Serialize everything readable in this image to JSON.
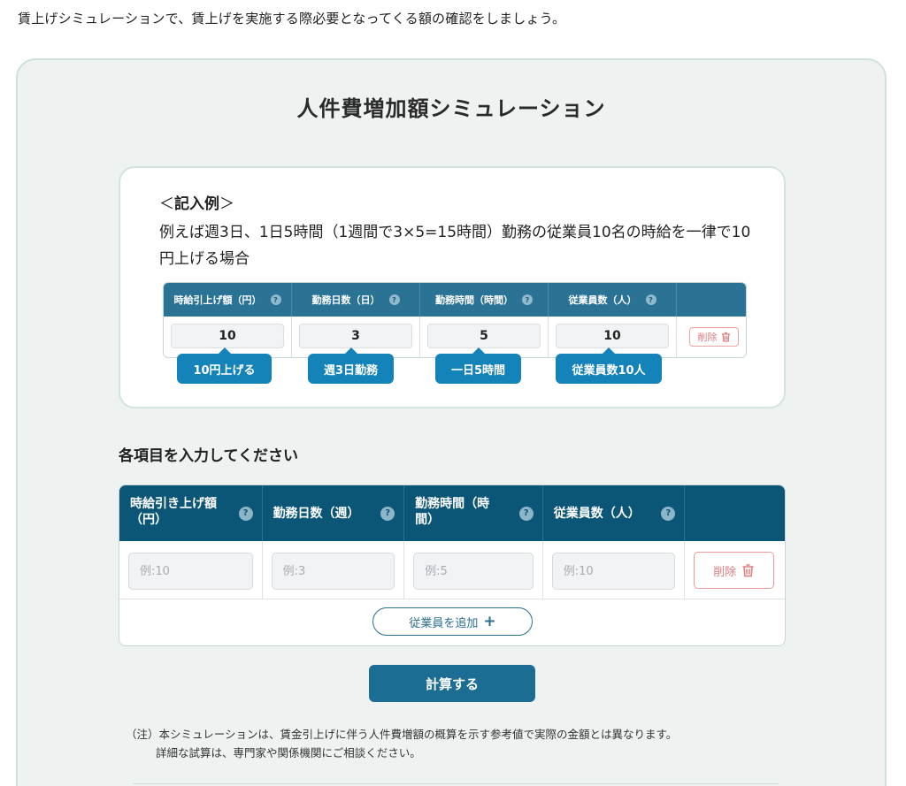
{
  "intro": "賃上げシミュレーションで、賃上げを実施する際必要となってくる額の確認をしましょう。",
  "panel": {
    "title": "人件費増加額シミュレーション"
  },
  "example": {
    "heading_open": "＜",
    "heading": "記入例",
    "heading_close": "＞",
    "description": "例えば週3日、1日5時間（1週間で3×5=15時間）勤務の従業員10名の時給を一律で10円上げる場合",
    "columns": [
      {
        "label": "時給引上げ額（円）",
        "help": "?"
      },
      {
        "label": "勤務日数（日）",
        "help": "?"
      },
      {
        "label": "勤務時間（時間）",
        "help": "?"
      },
      {
        "label": "従業員数（人）",
        "help": "?"
      }
    ],
    "values": [
      "10",
      "3",
      "5",
      "10"
    ],
    "delete_label": "削除",
    "callouts": [
      "10円上げる",
      "週3日勤務",
      "一日5時間",
      "従業員数10人"
    ]
  },
  "input_section": {
    "title": "各項目を入力してください",
    "columns": [
      {
        "label_line1": "時給引き上げ額",
        "label_line2": "（円）",
        "help": "?"
      },
      {
        "label_line1": "勤務日数（週）",
        "label_line2": "",
        "help": "?"
      },
      {
        "label_line1": "勤務時間（時",
        "label_line2": "間）",
        "help": "?"
      },
      {
        "label_line1": "従業員数（人）",
        "label_line2": "",
        "help": "?"
      }
    ],
    "placeholders": [
      "例:10",
      "例:3",
      "例:5",
      "例:10"
    ],
    "delete_label": "削除",
    "add_employee_label": "従業員を追加",
    "add_icon": "+"
  },
  "calculate_label": "計算する",
  "note": {
    "line1": "（注）本シミュレーションは、賃金引上げに伴う人件費増額の概算を示す参考値で実際の金額とは異なります。",
    "line2": "詳細な試算は、専門家や関係機関にご相談ください。"
  },
  "colors": {
    "panel_bg": "#eef3f2",
    "example_header": "#2b7394",
    "input_header": "#0b5677",
    "callout": "#1483b9",
    "calculate_button": "#1b6d94",
    "delete": "#e07b7b"
  }
}
